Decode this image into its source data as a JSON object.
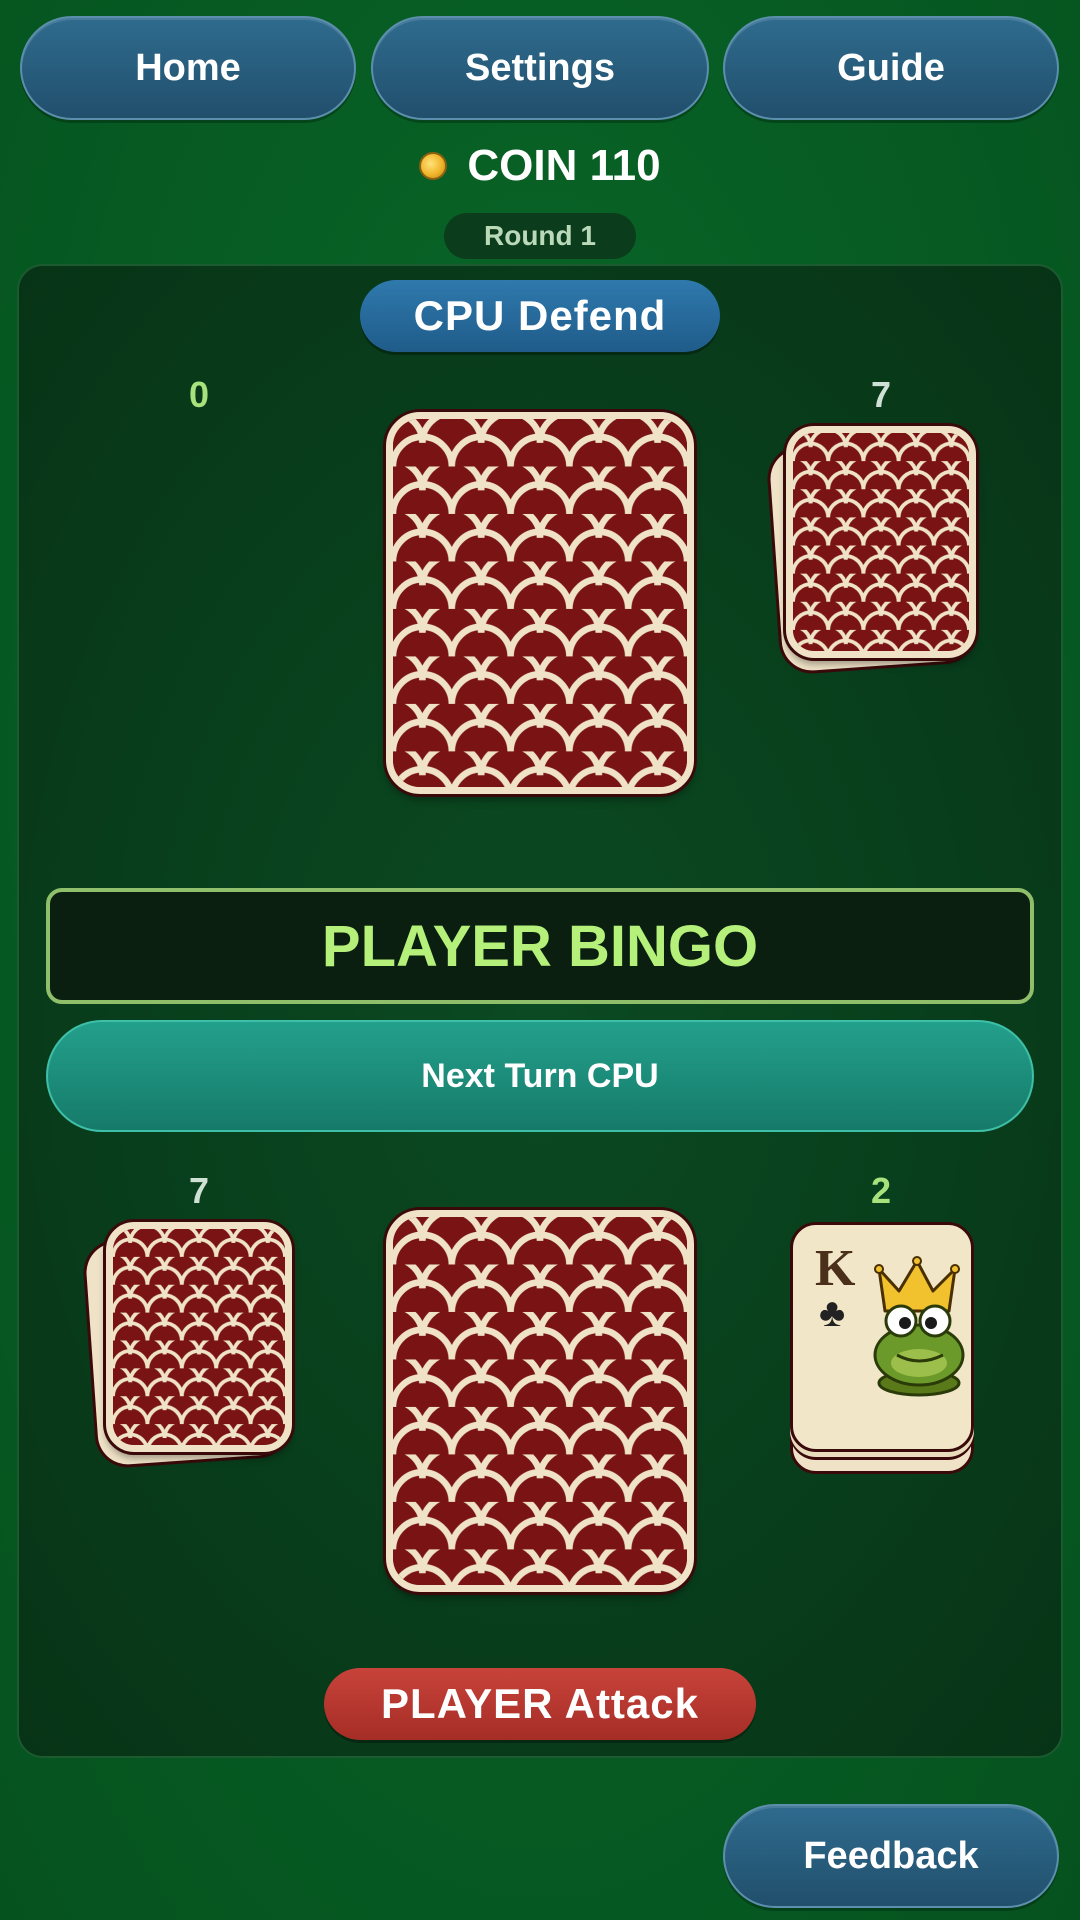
{
  "nav": {
    "home": "Home",
    "settings": "Settings",
    "guide": "Guide"
  },
  "coin": {
    "text": "COIN 110",
    "icon": "coin-icon"
  },
  "round": "Round 1",
  "cpu": {
    "role": "CPU Defend",
    "pile_count": "0",
    "hand_count": "7"
  },
  "banner": "PLAYER BINGO",
  "next_turn": "Next Turn CPU",
  "player": {
    "hand_count": "7",
    "pile_count": "2",
    "top_card": {
      "rank": "K",
      "suit": "♣",
      "suit_name": "clubs"
    },
    "role": "PLAYER Attack"
  },
  "feedback": "Feedback",
  "colors": {
    "felt": "#075e24",
    "card_back": "#7a1414",
    "card_trim": "#efe2c6",
    "banner_text": "#b4f07a",
    "cpu_badge": "#1f5c8a",
    "player_badge": "#a52d26",
    "next_button": "#167a69"
  }
}
